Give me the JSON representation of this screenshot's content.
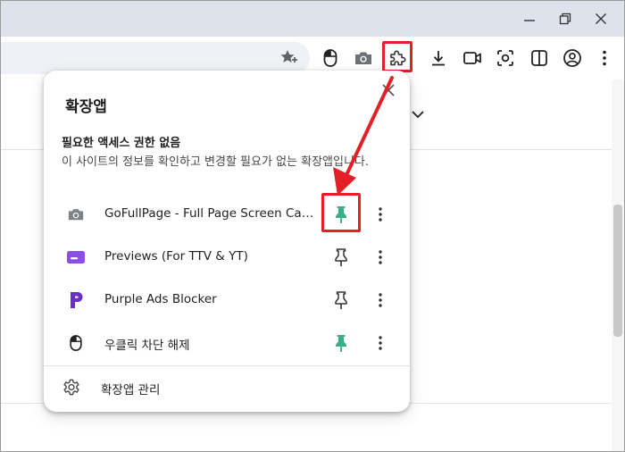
{
  "colors": {
    "titlebar_bg": "#dde3ea",
    "highlight_red": "#e32028",
    "pinned_green": "#3ab088",
    "purple": "#7b3fe4"
  },
  "toolbar": {
    "icons": [
      "bookmark-star-icon",
      "mouse-extension-icon",
      "camera-extension-icon",
      "extensions-puzzle-icon",
      "download-icon",
      "video-icon",
      "screenshot-icon",
      "side-panel-icon",
      "profile-icon",
      "menu-icon"
    ]
  },
  "popup": {
    "title": "확장앱",
    "section_title": "필요한 액세스 권한 없음",
    "section_desc": "이 사이트의 정보를 확인하고 변경할 필요가 없는 확장앱입니다.",
    "extensions": [
      {
        "name": "GoFullPage - Full Page Screen Capture",
        "icon": "camera-icon",
        "pinned": true
      },
      {
        "name": "Previews (For TTV & YT)",
        "icon": "previews-icon",
        "pinned": false
      },
      {
        "name": "Purple Ads Blocker",
        "icon": "purple-p-icon",
        "pinned": false
      },
      {
        "name": "우클릭 차단 해제",
        "icon": "mouse-icon",
        "pinned": true
      }
    ],
    "manage_label": "확장앱 관리"
  }
}
